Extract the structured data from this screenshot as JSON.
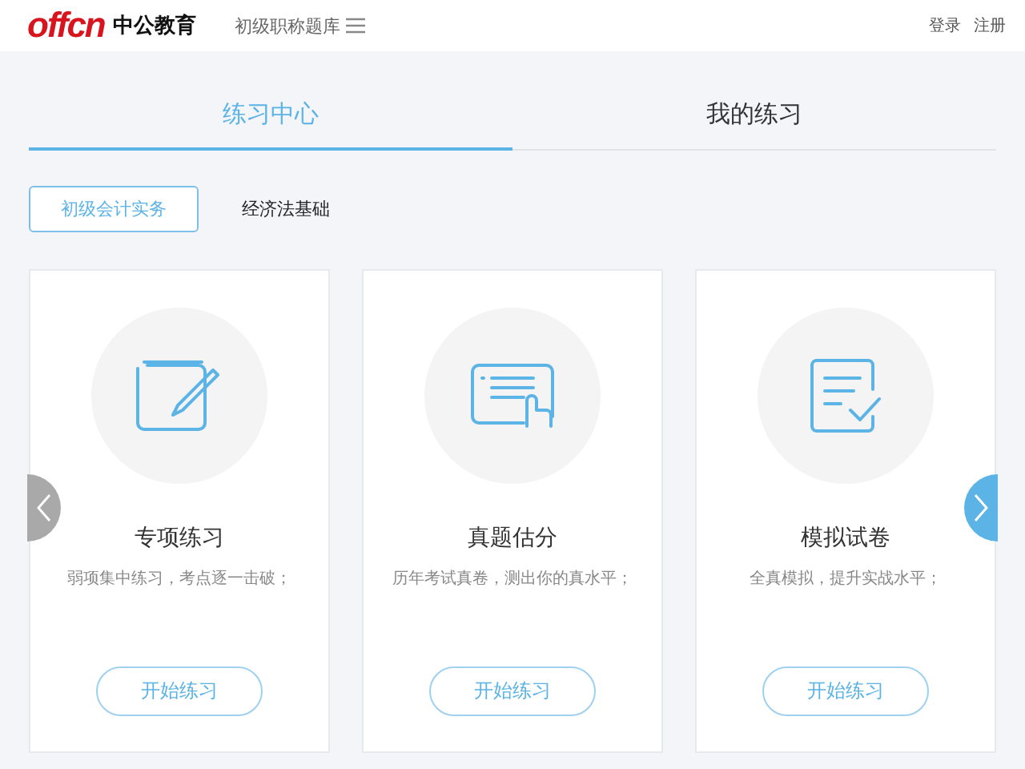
{
  "header": {
    "logo_text": "offcn",
    "brand": "中公教育",
    "menu_label": "初级职称题库",
    "links": [
      "登录",
      "注册"
    ]
  },
  "tabs": [
    {
      "label": "练习中心",
      "selected": true
    },
    {
      "label": "我的练习",
      "selected": false
    }
  ],
  "subjects": [
    {
      "label": "初级会计实务",
      "selected": true
    },
    {
      "label": "经济法基础",
      "selected": false
    }
  ],
  "cards": [
    {
      "kind": "edit",
      "title": "专项练习",
      "description": "弱项集中练习，考点逐一击破；",
      "button": "开始练习"
    },
    {
      "kind": "list",
      "title": "真题估分",
      "description": "历年考试真卷，测出你的真水平；",
      "button": "开始练习"
    },
    {
      "kind": "check",
      "title": "模拟试卷",
      "description": "全真模拟，提升实战水平；",
      "button": "开始练习"
    }
  ]
}
